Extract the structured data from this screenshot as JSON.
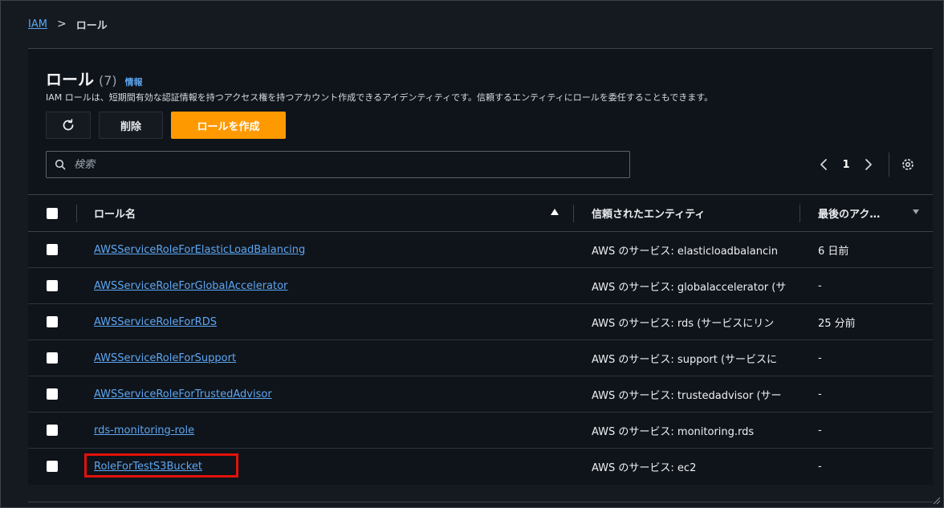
{
  "breadcrumb": {
    "root": "IAM",
    "separator": ">",
    "current": "ロール"
  },
  "header": {
    "title": "ロール",
    "count": "(7)",
    "info_link": "情報",
    "description": "IAM ロールは、短期間有効な認証情報を持つアクセス権を持つアカウント作成できるアイデンティティです。信頼するエンティティにロールを委任することもできます。"
  },
  "toolbar": {
    "refresh_icon": "refresh-icon",
    "delete_label": "削除",
    "create_label": "ロールを作成"
  },
  "search": {
    "icon": "search-icon",
    "placeholder": "検索",
    "value": ""
  },
  "pagination": {
    "prev_icon": "chevron-left-icon",
    "page": "1",
    "next_icon": "chevron-right-icon",
    "settings_icon": "gear-icon"
  },
  "table": {
    "columns": {
      "name": "ロール名",
      "entity": "信頼されたエンティティ",
      "last": "最後のアク…"
    },
    "rows": [
      {
        "name": "AWSServiceRoleForElasticLoadBalancing",
        "entity": "AWS のサービス: elasticloadbalancin",
        "last": "6 日前"
      },
      {
        "name": "AWSServiceRoleForGlobalAccelerator",
        "entity": "AWS のサービス: globalaccelerator (サ",
        "last": "-"
      },
      {
        "name": "AWSServiceRoleForRDS",
        "entity": "AWS のサービス: rds (サービスにリン",
        "last": "25 分前"
      },
      {
        "name": "AWSServiceRoleForSupport",
        "entity": "AWS のサービス: support (サービスに",
        "last": "-"
      },
      {
        "name": "AWSServiceRoleForTrustedAdvisor",
        "entity": "AWS のサービス: trustedadvisor (サー",
        "last": "-"
      },
      {
        "name": "rds-monitoring-role",
        "entity": "AWS のサービス: monitoring.rds",
        "last": "-"
      },
      {
        "name": "RoleForTestS3Bucket",
        "entity": "AWS のサービス: ec2",
        "last": "-"
      }
    ]
  },
  "colors": {
    "accent": "#ff9900",
    "link": "#5da6f2",
    "highlight": "#e3120b",
    "background": "#0f141a"
  }
}
